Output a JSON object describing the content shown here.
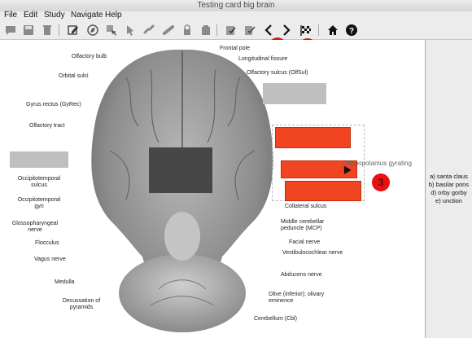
{
  "window": {
    "title": "Testing card big brain"
  },
  "menu": [
    "File",
    "Edit",
    "Study",
    "Navigate",
    "Help"
  ],
  "toolbar": {
    "icons": [
      "comment-icon",
      "save-icon",
      "trash-icon",
      "edit-card-icon",
      "compass-icon",
      "select-cursor-icon",
      "link-icon",
      "chain-icon",
      "lock-icon",
      "stack-icon",
      "checklist-icon",
      "check-icon",
      "prev-arrow-icon",
      "next-arrow-icon",
      "finish-flag-icon",
      "home-icon",
      "help-icon"
    ]
  },
  "markers": [
    "1",
    "2",
    "3"
  ],
  "labels_left": [
    "Olfactory bulb",
    "Orbital sulci",
    "Gyrus rectus (GyRec)",
    "Olfactory tract",
    "Occipitotemporal sulcus",
    "Occipitotemporal gyri",
    "Glossopharyngeal nerve",
    "Flocculus",
    "Vagus nerve",
    "Medulla",
    "Decussation of pyramids"
  ],
  "labels_right": [
    "Frontal pole",
    "Longitudinal fissure",
    "Olfactory sulcus (OlfSul)",
    "Collateral sulcus",
    "Middle cerebellar peduncle (MCP)",
    "Facial nerve",
    "Vestibulocochlear nerve",
    "Abducens nerve",
    "Olive (inferior); olivary eminence",
    "Cerebellum (Cbl)"
  ],
  "floating_answer": "hippopotamus gyrating",
  "answers": [
    "a) santa claus",
    "b) basilar pons",
    "d) orby gorby",
    "e) unction"
  ]
}
